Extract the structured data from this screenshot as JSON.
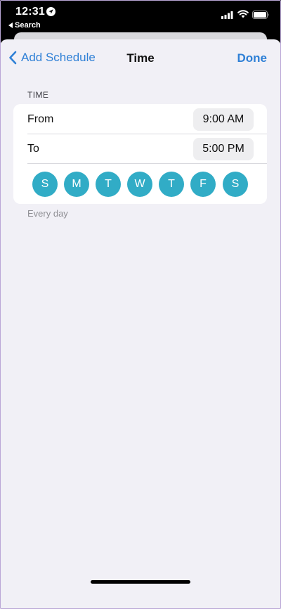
{
  "status_bar": {
    "time": "12:31",
    "back_label": "Search"
  },
  "nav": {
    "back_label": "Add Schedule",
    "title": "Time",
    "done_label": "Done"
  },
  "section": {
    "header": "TIME",
    "from_label": "From",
    "from_value": "9:00 AM",
    "to_label": "To",
    "to_value": "5:00 PM",
    "days": [
      "S",
      "M",
      "T",
      "W",
      "T",
      "F",
      "S"
    ],
    "footer": "Every day"
  },
  "colors": {
    "accent": "#2f80d6",
    "day_selected": "#31acc6",
    "sheet_background": "#f1f0f6"
  }
}
